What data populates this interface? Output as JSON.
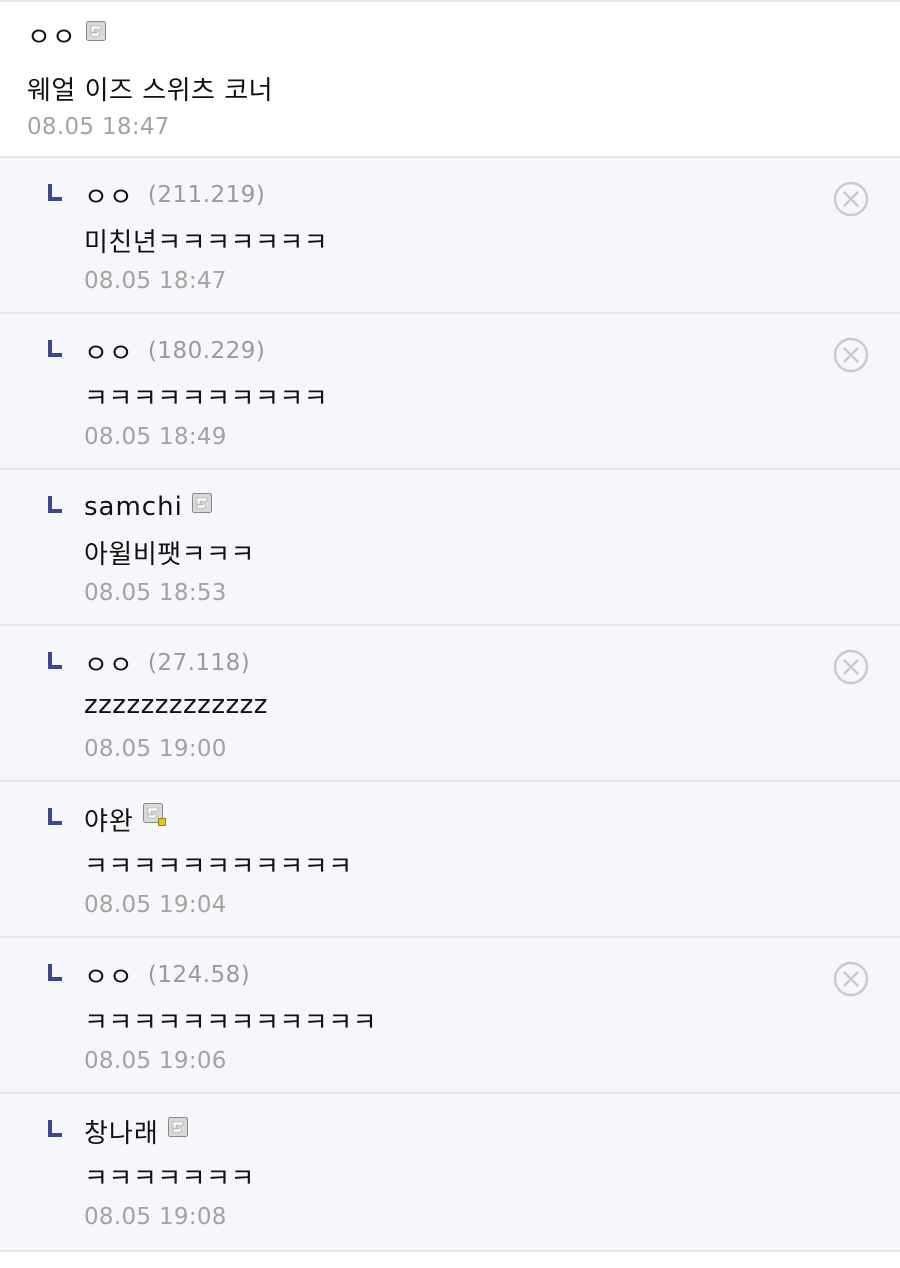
{
  "top_comment": {
    "nick": "ㅇㅇ",
    "badge": "fixed-nick-icon",
    "content": "웨얼 이즈 스위츠 코너",
    "date": "08.05 18:47"
  },
  "replies": [
    {
      "nick": "ㅇㅇ",
      "ip": "(211.219)",
      "content": "미친년ㅋㅋㅋㅋㅋㅋㅋ",
      "date": "08.05 18:47",
      "badge": null,
      "deletable": true
    },
    {
      "nick": "ㅇㅇ",
      "ip": "(180.229)",
      "content": "ㅋㅋㅋㅋㅋㅋㅋㅋㅋㅋ",
      "date": "08.05 18:49",
      "badge": null,
      "deletable": true
    },
    {
      "nick": "samchi",
      "ip": null,
      "content": "아윌비팻ㅋㅋㅋ",
      "date": "08.05 18:53",
      "badge": "fixed-nick-icon",
      "deletable": false
    },
    {
      "nick": "ㅇㅇ",
      "ip": "(27.118)",
      "content": "zzzzzzzzzzzzz",
      "date": "08.05 19:00",
      "badge": null,
      "deletable": true
    },
    {
      "nick": "야완",
      "ip": null,
      "content": "ㅋㅋㅋㅋㅋㅋㅋㅋㅋㅋㅋ",
      "date": "08.05 19:04",
      "badge": "half-fixed-nick-icon",
      "deletable": false
    },
    {
      "nick": "ㅇㅇ",
      "ip": "(124.58)",
      "content": "ㅋㅋㅋㅋㅋㅋㅋㅋㅋㅋㅋㅋ",
      "date": "08.05 19:06",
      "badge": null,
      "deletable": true
    },
    {
      "nick": "창나래",
      "ip": null,
      "content": "ㅋㅋㅋㅋㅋㅋㅋ",
      "date": "08.05 19:08",
      "badge": "fixed-nick-icon",
      "deletable": false
    }
  ],
  "colors": {
    "reply_background": "#f6f7fa",
    "divider": "#e3e5e8",
    "reply_arrow": "#3b4890",
    "meta_text": "#a3a3a3",
    "delete_icon": "#c8cad0",
    "half_fixed_badge_mark": "#e8c020"
  }
}
